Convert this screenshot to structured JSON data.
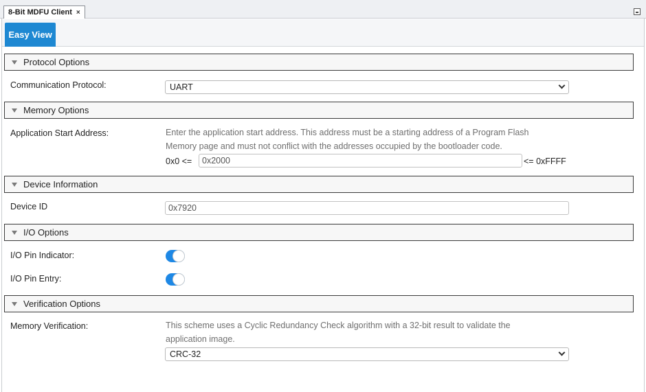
{
  "tab": {
    "title": "8-Bit MDFU Client",
    "close": "×"
  },
  "view": {
    "easy_view": "Easy View"
  },
  "sections": {
    "protocol": {
      "title": "Protocol Options",
      "comm_label": "Communication Protocol:",
      "comm_value": "UART"
    },
    "memory": {
      "title": "Memory Options",
      "start_label": "Application Start Address:",
      "start_desc_1": "Enter the application start address. This address must be a starting address of a Program Flash",
      "start_desc_2": "Memory page and must not conflict with the addresses occupied by the bootloader code.",
      "min_label": "0x0 <=",
      "value": "0x2000",
      "max_label": "<= 0xFFFF"
    },
    "device": {
      "title": "Device Information",
      "id_label": "Device ID",
      "id_value": "0x7920"
    },
    "io": {
      "title": "I/O Options",
      "indicator_label": "I/O Pin Indicator:",
      "indicator_on": true,
      "entry_label": "I/O Pin Entry:",
      "entry_on": true
    },
    "verification": {
      "title": "Verification Options",
      "mem_label": "Memory Verification:",
      "mem_desc_1": "This scheme uses a Cyclic Redundancy Check algorithm with a 32-bit result to validate the",
      "mem_desc_2": "application image.",
      "mem_value": "CRC-32"
    }
  },
  "colors": {
    "accent": "#1e88d2",
    "toggle_on": "#1e88e5"
  }
}
